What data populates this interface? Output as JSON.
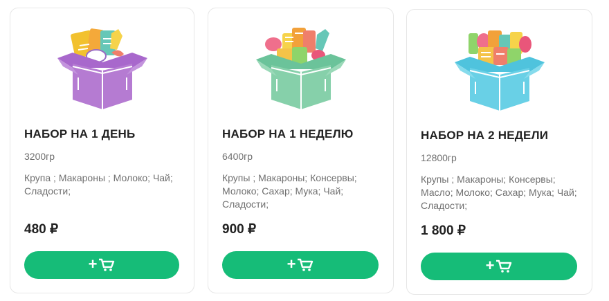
{
  "products": [
    {
      "title": "НАБОР НА 1 ДЕНЬ",
      "weight": "3200гр",
      "description": "Крупа ; Макароны ; Молоко; Чай; Сладости;",
      "price": "480 ₽",
      "cart_button_plus": "+",
      "cart_icon": "cart-icon",
      "box_color": "#b57bd2"
    },
    {
      "title": "НАБОР НА 1 НЕДЕЛЮ",
      "weight": "6400гр",
      "description": "Крупы ; Макароны; Консервы; Молоко; Сахар; Мука; Чай; Сладости;",
      "price": "900 ₽",
      "cart_button_plus": "+",
      "cart_icon": "cart-icon",
      "box_color": "#86d0aa"
    },
    {
      "title": "НАБОР НА 2 НЕДЕЛИ",
      "weight": "12800гр",
      "description": "Крупы ; Макароны; Консервы; Масло; Молоко; Сахар; Мука; Чай; Сладости;",
      "price": "1 800 ₽",
      "cart_button_plus": "+",
      "cart_icon": "cart-icon",
      "box_color": "#69d0e6"
    }
  ],
  "colors": {
    "button": "#16bc78",
    "text": "#222222",
    "muted": "#6f6f6f"
  }
}
